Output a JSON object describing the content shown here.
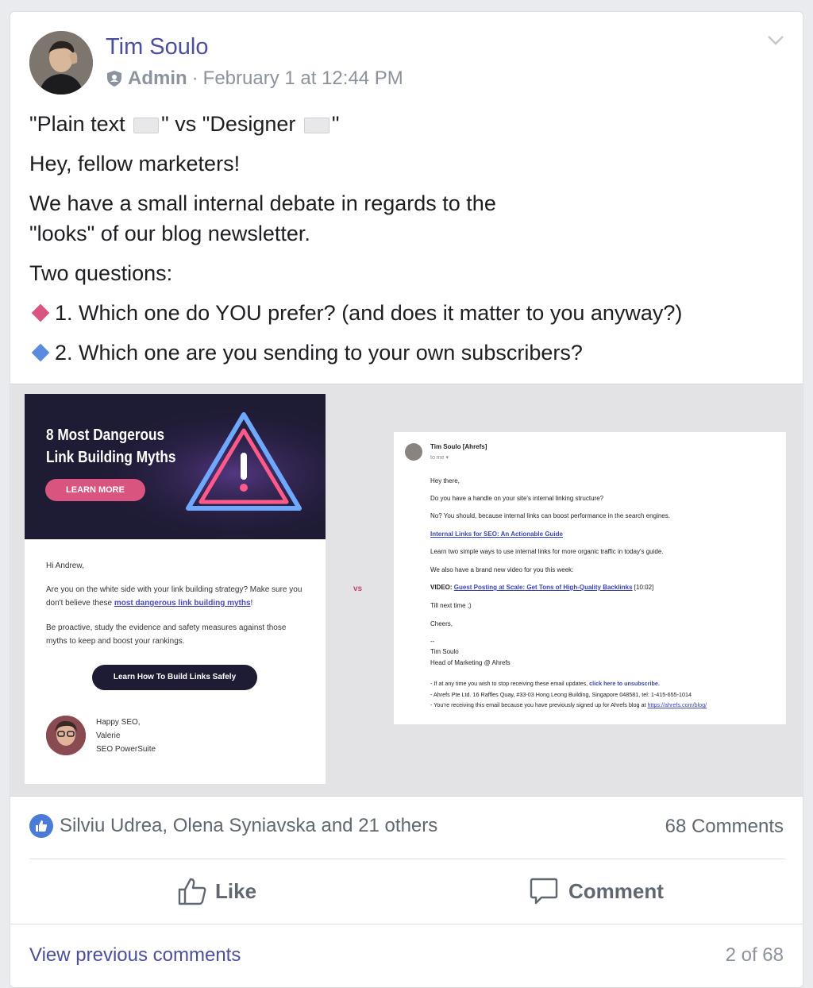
{
  "post": {
    "author": "Tim Soulo",
    "role": "Admin",
    "separator": "·",
    "timestamp": "February 1 at 12:44 PM",
    "title_part1": "\"Plain text ",
    "title_part2": "\" vs \"Designer ",
    "title_part3": "\"",
    "greeting": "Hey, fellow marketers!",
    "debate_line1": "We have a small internal debate in regards to the",
    "debate_line2": "\"looks\" of our blog newsletter.",
    "questions_intro": "Two questions:",
    "question1": "1. Which one do YOU prefer? (and does it matter to you anyway?)",
    "question2": "2. Which one are you sending to your own subscribers?"
  },
  "designer_email": {
    "hero_title_line1": "8 Most Dangerous",
    "hero_title_line2": "Link Building Myths",
    "learn_more": "LEARN MORE",
    "hi": "Hi Andrew,",
    "para1_part1": "Are you on the white side with your link building strategy? Make sure you don't believe these ",
    "para1_link": "most dangerous link building myths",
    "para1_part2": "!",
    "para2": "Be proactive, study the evidence and safety measures against those myths to keep and boost your rankings.",
    "cta": "Learn How To Build Links Safely",
    "sign1": "Happy SEO,",
    "sign2": "Valerie",
    "sign3": "SEO PowerSuite"
  },
  "vs_label": "vs",
  "plain_email": {
    "sender": "Tim Soulo [Ahrefs]",
    "to": "to me ▾",
    "l1": "Hey there,",
    "l2": "Do you have a handle on your site's internal linking structure?",
    "l3": "No? You should, because internal links can boost performance in the search engines.",
    "l4_link": "Internal Links for SEO: An Actionable Guide",
    "l5": "Learn two simple ways to use internal links for more organic traffic in today's guide.",
    "l6": "We also have a brand new video for you this week:",
    "l7_label": "VIDEO: ",
    "l7_link": "Guest Posting at Scale: Get Tons of High-Quality Backlinks",
    "l7_time": " [10:02]",
    "l8": "Till next time ;)",
    "l9": "Cheers,",
    "l10": "--",
    "l11": "Tim Soulo",
    "l12": "Head of Marketing @ Ahrefs",
    "f1_part1": "- If at any time you wish to stop receiving these email updates, ",
    "f1_bold": "click here to unsubscribe.",
    "f2": "- Ahrefs Pte Ltd. 16 Raffles Quay, #33-03 Hong Leong Building, Singapore 048581, tel: 1-415-655-1014",
    "f3_part1": "- You're receiving this email because you have previously signed up for Ahrefs blog at ",
    "f3_link": "https://ahrefs.com/blog/"
  },
  "reactions": {
    "names": "Silviu Udrea, Olena Syniavska and 21 others",
    "comments": "68 Comments"
  },
  "actions": {
    "like": "Like",
    "comment": "Comment"
  },
  "footer": {
    "view_previous": "View previous comments",
    "pager": "2 of 68"
  },
  "colors": {
    "author": "#4b4f9c",
    "bullet1": "#d95580",
    "bullet2": "#5b8be0",
    "like_badge": "#4a7bd8"
  }
}
